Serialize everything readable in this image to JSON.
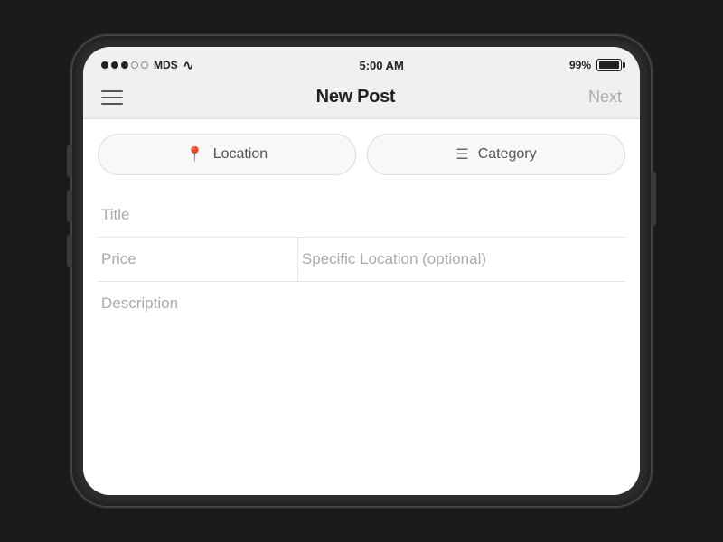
{
  "status_bar": {
    "carrier": "MDS",
    "time": "5:00 AM",
    "battery_percent": "99%"
  },
  "nav": {
    "title": "New Post",
    "next_label": "Next"
  },
  "filters": {
    "location_label": "Location",
    "category_label": "Category",
    "location_icon": "📍",
    "category_icon": "≡"
  },
  "form": {
    "title_placeholder": "Title",
    "price_placeholder": "Price",
    "specific_location_placeholder": "Specific Location (optional)",
    "description_placeholder": "Description"
  }
}
